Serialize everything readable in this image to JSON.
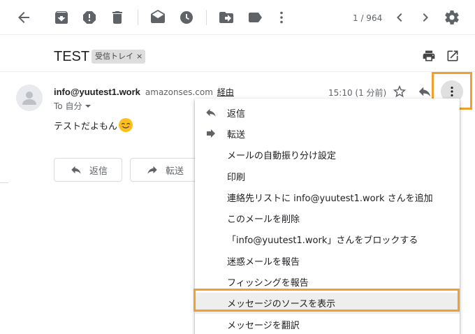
{
  "toolbar": {
    "pager": "1 / 964",
    "icons": [
      "back-arrow-icon",
      "archive-icon",
      "report-spam-icon",
      "delete-icon",
      "mark-unread-icon",
      "snooze-icon",
      "move-to-icon",
      "label-icon",
      "more-vert-icon",
      "chevron-left-icon",
      "chevron-right-icon",
      "settings-gear-icon"
    ]
  },
  "subject": {
    "title": "TEST",
    "label": "受信トレイ",
    "label_remove": "×"
  },
  "message": {
    "sender_name": "info@yuutest1.work",
    "sender_domain": "amazonses.com",
    "via": "経由",
    "to": "To 自分",
    "time": "15:10 (1 分前)",
    "body": "テストだよもん"
  },
  "actions": {
    "reply": "返信",
    "forward": "転送"
  },
  "menu": {
    "items": [
      {
        "label": "返信",
        "icon": "reply-icon"
      },
      {
        "label": "転送",
        "icon": "forward-icon"
      },
      {
        "label": "メールの自動振り分け設定",
        "icon": ""
      },
      {
        "label": "印刷",
        "icon": ""
      },
      {
        "label": "連絡先リストに info@yuutest1.work さんを追加",
        "icon": ""
      },
      {
        "label": "このメールを削除",
        "icon": ""
      },
      {
        "label": "「info@yuutest1.work」さんをブロックする",
        "icon": ""
      },
      {
        "label": "迷惑メールを報告",
        "icon": ""
      },
      {
        "label": "フィッシングを報告",
        "icon": ""
      },
      {
        "label": "メッセージのソースを表示",
        "icon": ""
      },
      {
        "label": "メッセージを翻訳",
        "icon": ""
      }
    ]
  },
  "colors": {
    "icon_gray": "#5f6368",
    "highlight": "#f0a030",
    "label_chip": "#dddddd"
  }
}
